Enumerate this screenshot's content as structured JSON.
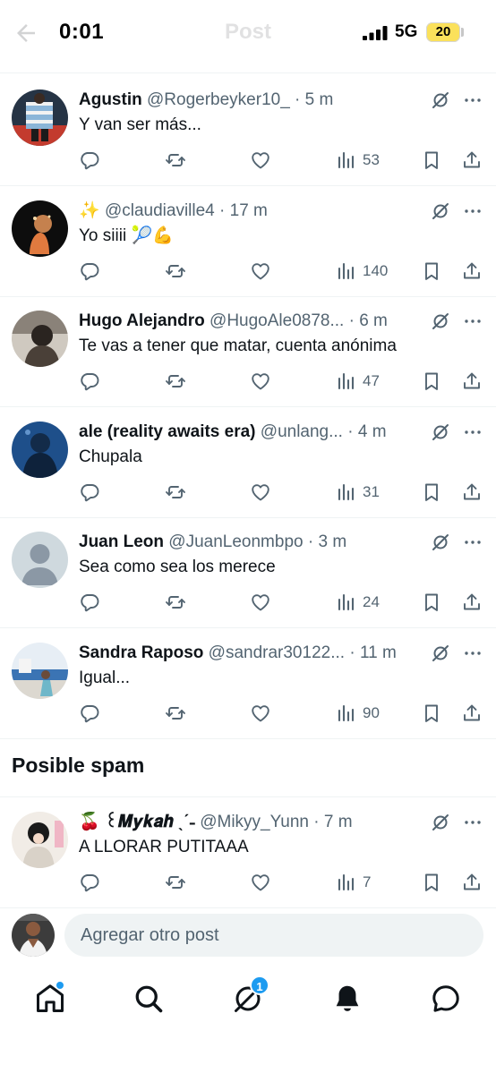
{
  "status_bar": {
    "time": "0:01",
    "network": "5G",
    "battery": "20",
    "battery_color": "#fbe15b"
  },
  "header": {
    "title": "Post",
    "back_icon": "arrow-left-icon"
  },
  "colors": {
    "text_primary": "#0f1419",
    "text_secondary": "#536471",
    "accent": "#1d9bf0",
    "divider": "#eff3f4"
  },
  "replies": [
    {
      "name": "Agustin",
      "handle": "@Rogerbeyker10_",
      "time": "5 m",
      "text": "Y van ser más...",
      "views": "53"
    },
    {
      "name": "✨",
      "handle": "@claudiaville4",
      "time": "17 m",
      "text": "Yo siiii 🎾💪",
      "views": "140"
    },
    {
      "name": "Hugo Alejandro",
      "handle": "@HugoAle0878...",
      "time": "6 m",
      "text": "Te vas a tener que matar, cuenta anónima",
      "views": "47"
    },
    {
      "name": "ale (reality awaits era)",
      "handle": "@unlang...",
      "time": "4 m",
      "text": "Chupala",
      "views": "31"
    },
    {
      "name": "Juan Leon",
      "handle": "@JuanLeonmbpo",
      "time": "3 m",
      "text": "Sea como sea los merece",
      "views": "24"
    },
    {
      "name": "Sandra Raposo",
      "handle": "@sandrar30122...",
      "time": "11 m",
      "text": "Igual...",
      "views": "90"
    }
  ],
  "spam_section": {
    "title": "Posible spam",
    "replies": [
      {
        "name": "🍒 ꒰𝑴𝒚𝒌𝒂𝒉 ˎˊ˗",
        "handle": "@Mikyy_Yunn",
        "time": "7 m",
        "text": "A LLORAR PUTITAAA",
        "views": "7"
      }
    ]
  },
  "composer": {
    "placeholder": "Agregar otro post"
  },
  "bottom_nav": {
    "items": [
      "home-icon",
      "search-icon",
      "grok-icon",
      "bell-icon",
      "messages-icon"
    ],
    "grok_badge": "1"
  }
}
